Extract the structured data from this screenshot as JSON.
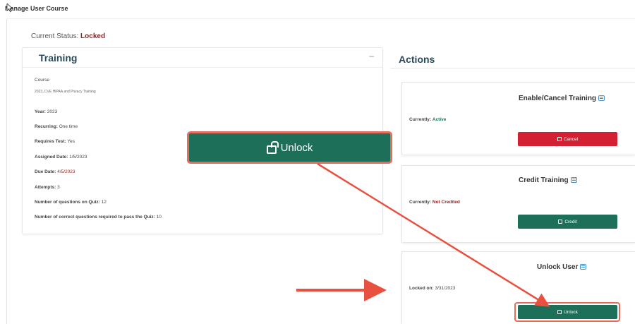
{
  "page": {
    "title": "Manage User Course"
  },
  "status": {
    "label": "Current Status:",
    "value": "Locked"
  },
  "training": {
    "title": "Training",
    "collapse_symbol": "–",
    "course_label": "Course",
    "course_name": "2023_CVE HIPAA and Privacy Training",
    "year_label": "Year:",
    "year": "2023",
    "recurring_label": "Recurring:",
    "recurring": "One time",
    "requires_test_label": "Requires Test:",
    "requires_test": "Yes",
    "assigned_label": "Assigned Date:",
    "assigned": "1/5/2023",
    "due_label": "Due Date:",
    "due": "4/5/2023",
    "attempts_label": "Attempts:",
    "attempts": "3",
    "questions_label": "Number of questions on Quiz:",
    "questions": "12",
    "correct_label": "Number of correct questions required to pass the Quiz:",
    "correct": "10"
  },
  "actions": {
    "title": "Actions",
    "enable_cancel": {
      "title": "Enable/Cancel Training",
      "currently_label": "Currently:",
      "currently_value": "Active",
      "button": "Cancel"
    },
    "credit": {
      "title": "Credit Training",
      "currently_label": "Currently:",
      "currently_value": "Not Credited",
      "button": "Credit"
    },
    "unlock": {
      "title": "Unlock User",
      "locked_label": "Locked on:",
      "locked_value": "3/31/2023",
      "button": "Unlock"
    }
  },
  "callout": {
    "button": "Unlock"
  },
  "colors": {
    "accent_green": "#1e6f5a",
    "danger_red": "#d32032",
    "annotation": "#e8503f",
    "locked_red": "#9b1c1c"
  }
}
